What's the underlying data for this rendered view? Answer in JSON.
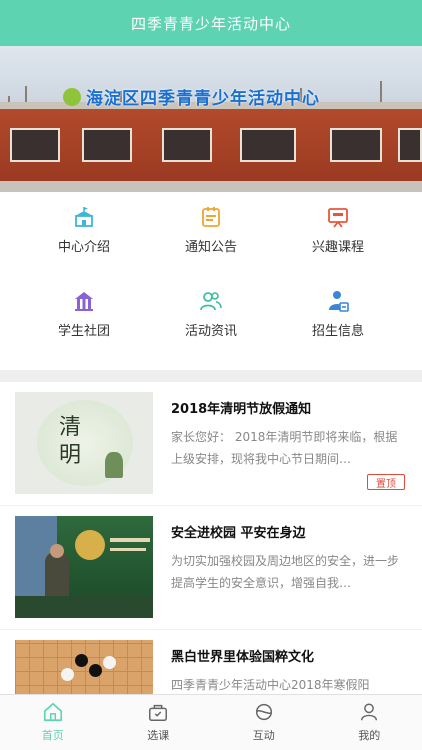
{
  "header": {
    "title": "四季青青少年活动中心"
  },
  "banner": {
    "sign_text": "海淀区四季青青少年活动中心"
  },
  "grid": {
    "items": [
      {
        "label": "中心介绍",
        "icon": "school-icon",
        "color": "#3fb6d8"
      },
      {
        "label": "通知公告",
        "icon": "notice-icon",
        "color": "#f0a431"
      },
      {
        "label": "兴趣课程",
        "icon": "course-board-icon",
        "color": "#e8553c"
      },
      {
        "label": "学生社团",
        "icon": "club-icon",
        "color": "#8a63d2"
      },
      {
        "label": "活动资讯",
        "icon": "people-icon",
        "color": "#3cc0a0"
      },
      {
        "label": "招生信息",
        "icon": "enroll-icon",
        "color": "#3a86d9"
      }
    ]
  },
  "news": {
    "items": [
      {
        "title": "2018年清明节放假通知",
        "summary": "家长您好：  2018年清明节即将来临，根据上级安排，现将我中心节日期间…",
        "badge": "置顶",
        "thumb_text": "清明"
      },
      {
        "title": "安全进校园  平安在身边",
        "summary": "为切实加强校园及周边地区的安全，进一步提高学生的安全意识，增强自我…",
        "badge": ""
      },
      {
        "title": "黑白世界里体验国粹文化",
        "summary": "四季青青少年活动中心2018年寒假阳",
        "badge": ""
      }
    ]
  },
  "tabbar": {
    "items": [
      {
        "label": "首页",
        "icon": "home-icon",
        "active": true
      },
      {
        "label": "选课",
        "icon": "course-select-icon",
        "active": false
      },
      {
        "label": "互动",
        "icon": "interact-icon",
        "active": false
      },
      {
        "label": "我的",
        "icon": "user-icon",
        "active": false
      }
    ],
    "accent": "#5ed3b1"
  }
}
